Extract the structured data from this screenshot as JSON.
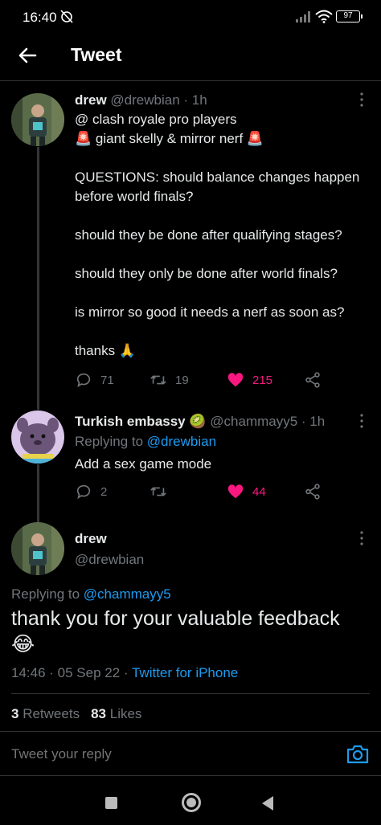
{
  "status": {
    "time": "16:40",
    "battery": "97"
  },
  "header": {
    "title": "Tweet"
  },
  "tweet1": {
    "name": "drew",
    "handle": "@drewbian",
    "time": "· 1h",
    "text": "@ clash royale pro players\n🚨 giant skelly & mirror nerf 🚨\n\nQUESTIONS: should balance changes happen before world finals?\n\nshould they be done after qualifying stages?\n\nshould they only be done after world finals?\n\nis mirror so good it needs a nerf as soon as?\n\nthanks 🙏",
    "replies": "71",
    "retweets": "19",
    "likes": "215"
  },
  "tweet2": {
    "name": "Turkish embassy",
    "badge": "🥝",
    "handle": "@chammayy5",
    "time": "· 1h",
    "replying_prefix": "Replying to ",
    "replying_to": "@drewbian",
    "text": "Add a sex game mode",
    "replies": "2",
    "retweets": "",
    "likes": "44"
  },
  "main_tweet": {
    "name": "drew",
    "handle": "@drewbian",
    "replying_prefix": "Replying to ",
    "replying_to": "@chammayy5",
    "text": "thank you for your valuable feedback\n😂",
    "timestamp": "14:46 · 05 Sep 22 · ",
    "source": "Twitter for iPhone",
    "retweet_count": "3",
    "retweet_label": "Retweets",
    "like_count": "83",
    "like_label": "Likes"
  },
  "reply": {
    "placeholder": "Tweet your reply"
  },
  "colors": {
    "accent": "#1d9bf0",
    "like": "#f91880",
    "muted": "#71767b",
    "background": "#000000"
  },
  "icons": [
    "back-arrow-icon",
    "more-icon",
    "reply-icon",
    "retweet-icon",
    "heart-icon",
    "share-icon",
    "camera-icon"
  ]
}
